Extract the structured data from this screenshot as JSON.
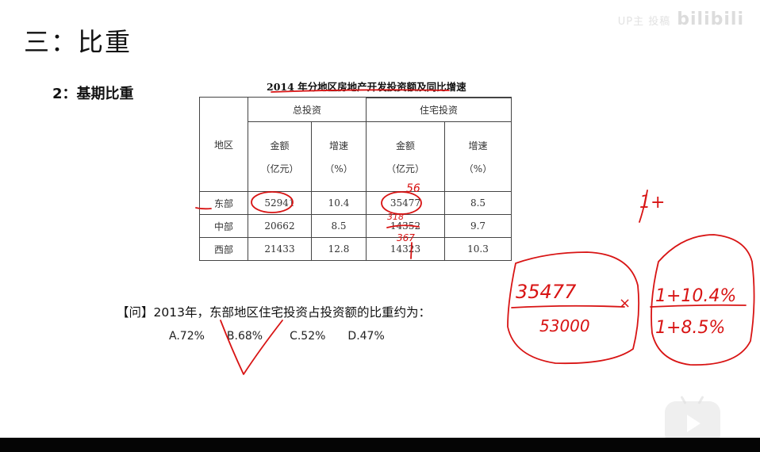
{
  "watermark": {
    "text": "bilibili",
    "prefix": "UP主 投稿"
  },
  "slide": {
    "section_title": "三：比重",
    "subsection": "2：基期比重"
  },
  "table": {
    "caption": "2014 年分地区房地产开发投资额及同比增速",
    "headers": {
      "region": "地区",
      "total_investment": "总投资",
      "residential_investment": "住宅投资",
      "amount": "金额",
      "amount_unit": "（亿元）",
      "growth": "增速",
      "growth_unit": "（%）"
    },
    "rows": [
      {
        "region": "东部",
        "total_amount": "52941",
        "total_growth": "10.4",
        "res_amount": "35477",
        "res_growth": "8.5"
      },
      {
        "region": "中部",
        "total_amount": "20662",
        "total_growth": "8.5",
        "res_amount": "14352",
        "res_growth": "9.7"
      },
      {
        "region": "西部",
        "total_amount": "21433",
        "total_growth": "12.8",
        "res_amount": "14323",
        "res_growth": "10.3"
      }
    ]
  },
  "question": {
    "text": "【问】2013年，东部地区住宅投资占投资额的比重约为：",
    "options": [
      "A.72%",
      "B.68%",
      "C.52%",
      "D.47%"
    ]
  },
  "annotations": {
    "hand_num1": "35477",
    "hand_den1": "53000",
    "hand_times": "×",
    "hand_num2": "1+10.4%",
    "hand_den2": "1+8.5%",
    "hand_one_plus": "1+",
    "hand_top": "56",
    "hand_mid1": "318",
    "hand_mid2": "367",
    "ink_color": "#d81414"
  },
  "player": {
    "logo_icon": "bilibili-play-icon"
  }
}
